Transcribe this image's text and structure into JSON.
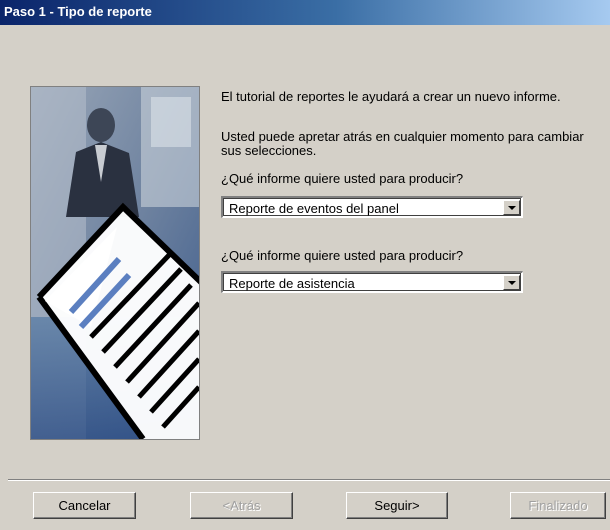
{
  "window": {
    "title": "Paso 1 - Tipo de reporte"
  },
  "intro": {
    "line1": "El tutorial de reportes le ayudará a crear un nuevo informe.",
    "line2": "Usted puede apretar atrás en cualquier momento para cambiar sus selecciones."
  },
  "question1": {
    "label": "¿Qué informe quiere usted para producir?",
    "selected": "Reporte de  eventos del panel"
  },
  "question2": {
    "label": "¿Qué informe quiere usted para producir?",
    "selected": "Reporte de asistencia"
  },
  "buttons": {
    "cancel": "Cancelar",
    "back": "<Atrás",
    "next": "Seguir>",
    "finish": "Finalizado"
  },
  "icons": {
    "dropdown": "chevron-down-icon",
    "illustration": "report-wizard-illustration"
  },
  "colors": {
    "titlebar": "#0a246a",
    "dialog": "#d4d0c8"
  }
}
